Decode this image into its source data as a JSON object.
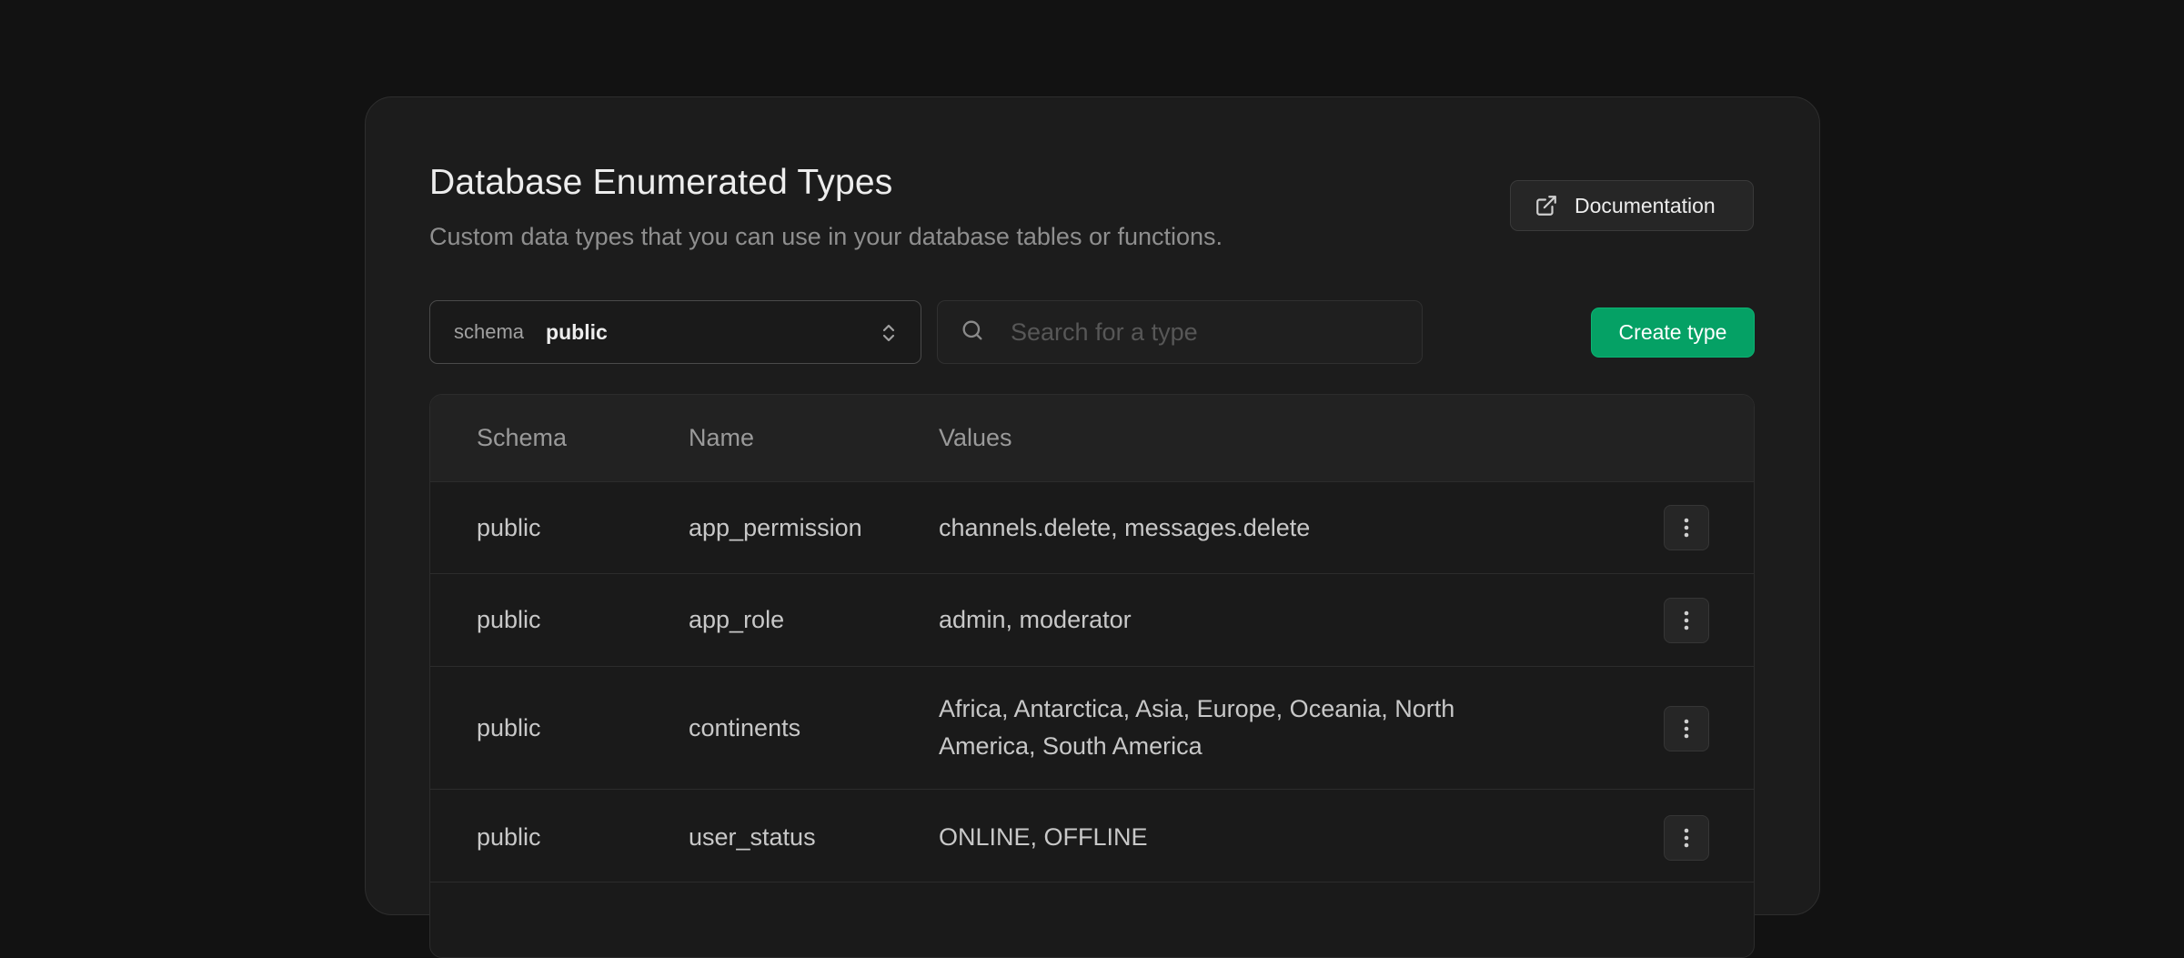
{
  "header": {
    "title": "Database Enumerated Types",
    "subtitle": "Custom data types that you can use in your database tables or functions.",
    "documentation_label": "Documentation"
  },
  "toolbar": {
    "schema_prefix": "schema",
    "schema_value": "public",
    "search_placeholder": "Search for a type",
    "search_value": "",
    "create_label": "Create type"
  },
  "table": {
    "columns": [
      "Schema",
      "Name",
      "Values"
    ],
    "rows": [
      {
        "schema": "public",
        "name": "app_permission",
        "values": "channels.delete, messages.delete"
      },
      {
        "schema": "public",
        "name": "app_role",
        "values": "admin, moderator"
      },
      {
        "schema": "public",
        "name": "continents",
        "values": "Africa, Antarctica, Asia, Europe, Oceania, North America, South America"
      },
      {
        "schema": "public",
        "name": "user_status",
        "values": "ONLINE, OFFLINE"
      }
    ]
  },
  "colors": {
    "background": "#121212",
    "panel": "#1c1c1c",
    "accent": "#05a165"
  },
  "icons": {
    "documentation": "external-link-icon",
    "select": "chevron-up-down-icon",
    "search": "search-icon",
    "row_menu": "more-vertical-icon"
  }
}
